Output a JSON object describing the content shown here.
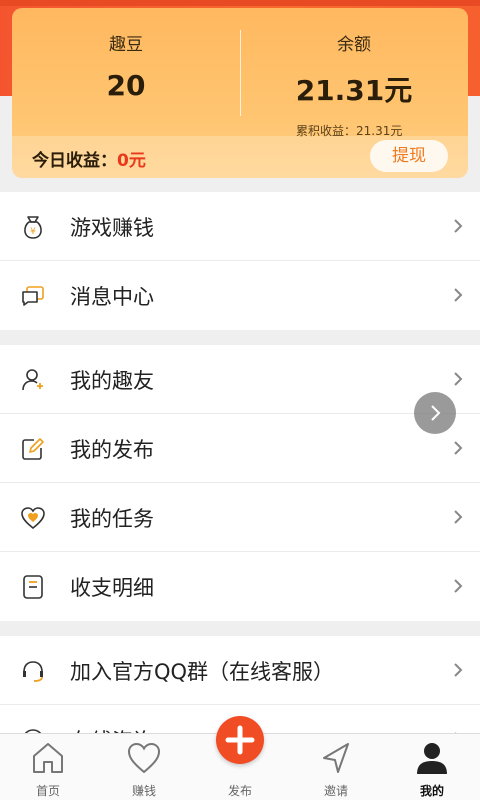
{
  "wallet": {
    "beans_label": "趣豆",
    "beans_value": "20",
    "balance_label": "余额",
    "balance_value": "21.31元",
    "cumulative": "累积收益：21.31元",
    "today_label": "今日收益：",
    "today_value": "0元",
    "withdraw_label": "提现"
  },
  "menu_group1": [
    {
      "label": "游戏赚钱",
      "icon": "money-bag-icon"
    },
    {
      "label": "消息中心",
      "icon": "message-icon"
    }
  ],
  "menu_group2": [
    {
      "label": "我的趣友",
      "icon": "friend-icon"
    },
    {
      "label": "我的发布",
      "icon": "edit-icon"
    },
    {
      "label": "我的任务",
      "icon": "heart-task-icon"
    },
    {
      "label": "收支明细",
      "icon": "ledger-icon"
    }
  ],
  "menu_group3": [
    {
      "label": "加入官方QQ群（在线客服）",
      "icon": "headset-icon"
    },
    {
      "label": "在线咨询",
      "icon": "chat-icon"
    }
  ],
  "tabs": [
    {
      "label": "首页",
      "icon": "home-icon"
    },
    {
      "label": "赚钱",
      "icon": "heart-icon"
    },
    {
      "label": "发布",
      "icon": "plus-icon"
    },
    {
      "label": "邀请",
      "icon": "send-icon"
    },
    {
      "label": "我的",
      "icon": "user-icon"
    }
  ],
  "colors": {
    "header": "#f4552f",
    "card": "#ffc571",
    "accent": "#f04d25",
    "amount_red": "#e9391b"
  }
}
